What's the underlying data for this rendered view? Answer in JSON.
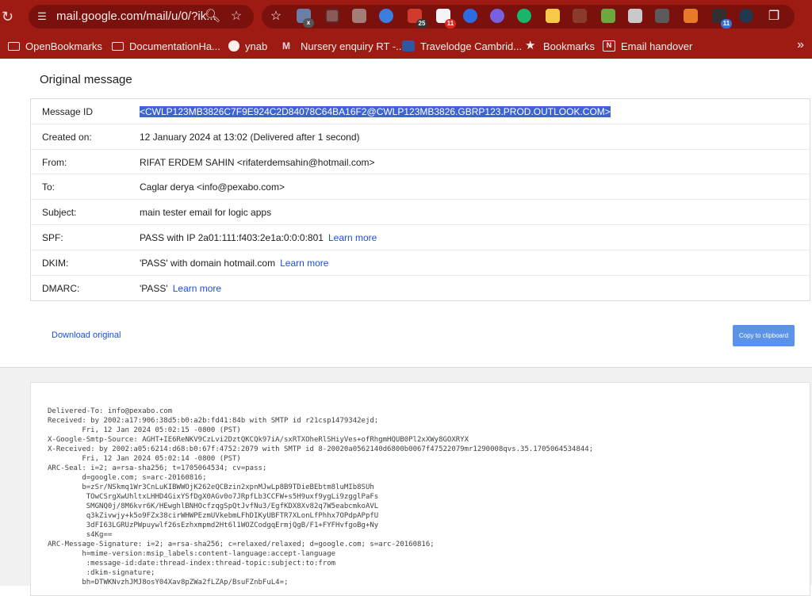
{
  "browser": {
    "url": "mail.google.com/mail/u/0/?ik...",
    "colors": {
      "toolbar": "#9e1b14",
      "omnibox": "#7a110c",
      "link": "#1a4fd6",
      "selection": "#3e64d4"
    },
    "extension_badges": {
      "ext_2": "25",
      "ext_3": "11",
      "ext_14": "11"
    }
  },
  "bookmarks": [
    {
      "label": "OpenBookmarks",
      "icon": "folder-icon"
    },
    {
      "label": "DocumentationHa...",
      "icon": "folder-icon"
    },
    {
      "label": "ynab",
      "icon": "wordpress-icon"
    },
    {
      "label": "Nursery enquiry RT -...",
      "icon": "gmail-icon"
    },
    {
      "label": "Travelodge Cambrid...",
      "icon": "travelodge-icon"
    },
    {
      "label": "Bookmarks",
      "icon": "star-icon"
    },
    {
      "label": "Email handover",
      "icon": "notion-icon"
    }
  ],
  "page": {
    "title": "Original message",
    "rows": {
      "message_id": {
        "label": "Message ID",
        "value": "<CWLP123MB3826C7F9E924C2D84078C64BA16F2@CWLP123MB3826.GBRP123.PROD.OUTLOOK.COM>"
      },
      "created": {
        "label": "Created on:",
        "value": "12 January 2024 at 13:02 (Delivered after 1 second)"
      },
      "from": {
        "label": "From:",
        "value": "RIFAT ERDEM SAHIN <rifaterdemsahin@hotmail.com>"
      },
      "to": {
        "label": "To:",
        "value": "Caglar derya <info@pexabo.com>"
      },
      "subject": {
        "label": "Subject:",
        "value": "main tester email for logic apps"
      },
      "spf": {
        "label": "SPF:",
        "value": "PASS with IP 2a01:111:f403:2e1a:0:0:0:801",
        "link": "Learn more"
      },
      "dkim": {
        "label": "DKIM:",
        "value": "'PASS' with domain hotmail.com",
        "link": "Learn more"
      },
      "dmarc": {
        "label": "DMARC:",
        "value": "'PASS'",
        "link": "Learn more"
      }
    },
    "download_label": "Download original",
    "copy_label": "Copy to clipboard"
  },
  "raw_headers": "Delivered-To: info@pexabo.com\nReceived: by 2002:a17:906:38d5:b0:a2b:fd41:84b with SMTP id r21csp1479342ejd;\n        Fri, 12 Jan 2024 05:02:15 -0800 (PST)\nX-Google-Smtp-Source: AGHT+IE6ReNKV9CzLvi2DztQKCQk97iA/sxRTXOheRlSHiyVes+ofRhgmHQUB0Pl2xXWy8GOXRYX\nX-Received: by 2002:a05:6214:d68:b0:67f:4752:2079 with SMTP id 8-20020a0562140d6800b0067f47522079mr1290008qvs.35.1705064534844;\n        Fri, 12 Jan 2024 05:02:14 -0800 (PST)\nARC-Seal: i=2; a=rsa-sha256; t=1705064534; cv=pass;\n        d=google.com; s=arc-20160816;\n        b=zSr/NSkmq1Wr3CnLuKIBWWOjK262eQCBzin2xpnMJwLp8B9TDieBEbtm8luMIb8SUh\n         TOwCSrgXwUhltxLHHD4GixYSfDgX0AGv0o7JRpfLb3CCFW+s5H9uxf9ygLi9zgglPaFs\n         SMGNQ0j/8M6kvr6K/HEwghlBNHOcfzqgSpQtJvfNu3/EgfKDX8Xv82q7W5eabcmkoAVL\n         q3kZivwjy+k5o9FZx38cirWHWPEzmUVkebmLFhDIKyUBFTR7XLonLfPhhx7OPdpAPpfU\n         3dFI63LGRUzPWpuywlf26sEzhxmpmd2Ht6l1WOZCodgqErmjQgB/F1+FYFHvfgoBg+Ny\n         s4Kg==\nARC-Message-Signature: i=2; a=rsa-sha256; c=relaxed/relaxed; d=google.com; s=arc-20160816;\n        h=mime-version:msip_labels:content-language:accept-language\n         :message-id:date:thread-index:thread-topic:subject:to:from\n         :dkim-signature;\n        bh=DTWKNvzhJMJ8osY04Xav8pZWa2fLZAp/BsuFZnbFuL4=;"
}
